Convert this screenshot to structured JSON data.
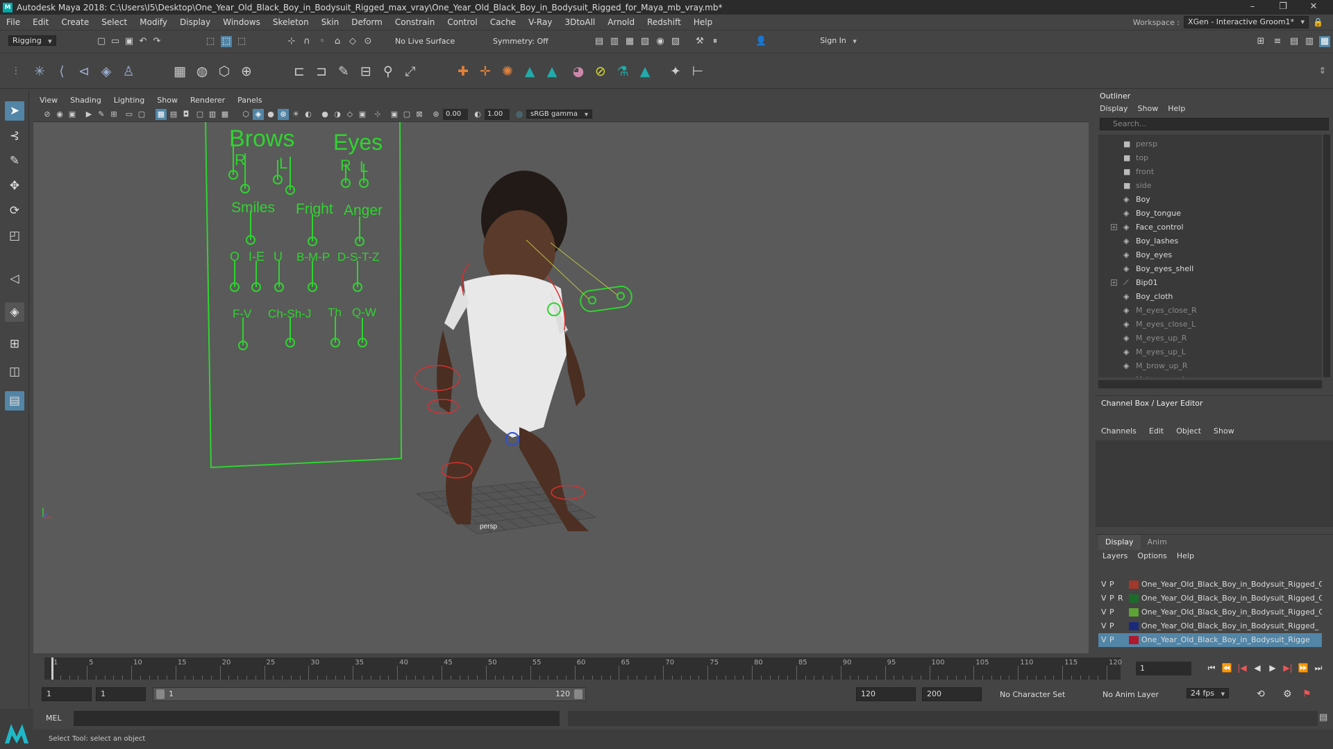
{
  "window": {
    "title": "Autodesk Maya 2018: C:\\Users\\I5\\Desktop\\One_Year_Old_Black_Boy_in_Bodysuit_Rigged_max_vray\\One_Year_Old_Black_Boy_in_Bodysuit_Rigged_for_Maya_mb_vray.mb*",
    "app_icon": "M"
  },
  "menubar": [
    "File",
    "Edit",
    "Create",
    "Select",
    "Modify",
    "Display",
    "Windows",
    "Skeleton",
    "Skin",
    "Deform",
    "Constrain",
    "Control",
    "Cache",
    "V-Ray",
    "3DtoAll",
    "Arnold",
    "Redshift",
    "Help"
  ],
  "workspace": {
    "label": "Workspace :",
    "value": "XGen - Interactive Groom1*"
  },
  "statusline": {
    "mode": "Rigging",
    "live_surface": "No Live Surface",
    "symmetry": "Symmetry: Off",
    "signin": "Sign In"
  },
  "viewport": {
    "menu": [
      "View",
      "Shading",
      "Lighting",
      "Show",
      "Renderer",
      "Panels"
    ],
    "field1": "0.00",
    "field2": "1.00",
    "colorspace": "sRGB gamma",
    "camera_label": "persp",
    "rig": {
      "brows": "Brows",
      "eyes": "Eyes",
      "r": "R",
      "l": "L",
      "eyes_r": "R",
      "eyes_l": "L",
      "smiles": "Smiles",
      "fright": "Fright",
      "anger": "Anger",
      "o": "O",
      "ie": "I-E",
      "u": "U",
      "bmp": "B-M-P",
      "dstz": "D-S-T-Z",
      "fv": "F-V",
      "chshj": "Ch-Sh-J",
      "th": "Th",
      "qw": "Q-W"
    }
  },
  "outliner": {
    "title": "Outliner",
    "menu": [
      "Display",
      "Show",
      "Help"
    ],
    "search_placeholder": "Search...",
    "items": [
      {
        "name": "persp",
        "type": "camera",
        "dim": true,
        "expand": false
      },
      {
        "name": "top",
        "type": "camera",
        "dim": true,
        "expand": false
      },
      {
        "name": "front",
        "type": "camera",
        "dim": true,
        "expand": false
      },
      {
        "name": "side",
        "type": "camera",
        "dim": true,
        "expand": false
      },
      {
        "name": "Boy",
        "type": "mesh",
        "dim": false,
        "expand": false
      },
      {
        "name": "Boy_tongue",
        "type": "mesh",
        "dim": false,
        "expand": false
      },
      {
        "name": "Face_control",
        "type": "mesh",
        "dim": false,
        "expand": true
      },
      {
        "name": "Boy_lashes",
        "type": "mesh",
        "dim": false,
        "expand": false
      },
      {
        "name": "Boy_eyes",
        "type": "mesh",
        "dim": false,
        "expand": false
      },
      {
        "name": "Boy_eyes_shell",
        "type": "mesh",
        "dim": false,
        "expand": false
      },
      {
        "name": "Bip01",
        "type": "joint",
        "dim": false,
        "expand": true
      },
      {
        "name": "Boy_cloth",
        "type": "mesh",
        "dim": false,
        "expand": false
      },
      {
        "name": "M_eyes_close_R",
        "type": "mesh",
        "dim": true,
        "expand": false
      },
      {
        "name": "M_eyes_close_L",
        "type": "mesh",
        "dim": true,
        "expand": false
      },
      {
        "name": "M_eyes_up_R",
        "type": "mesh",
        "dim": true,
        "expand": false
      },
      {
        "name": "M_eyes_up_L",
        "type": "mesh",
        "dim": true,
        "expand": false
      },
      {
        "name": "M_brow_up_R",
        "type": "mesh",
        "dim": true,
        "expand": false
      },
      {
        "name": "M_brow_up_L",
        "type": "mesh",
        "dim": true,
        "expand": false
      }
    ]
  },
  "channelbox": {
    "title": "Channel Box / Layer Editor",
    "menu": [
      "Channels",
      "Edit",
      "Object",
      "Show"
    ]
  },
  "layereditor": {
    "tabs": [
      "Display",
      "Anim"
    ],
    "menu": [
      "Layers",
      "Options",
      "Help"
    ],
    "layers": [
      {
        "v": "V",
        "p": "P",
        "r": "",
        "color": "#a0392a",
        "name": "One_Year_Old_Black_Boy_in_Bodysuit_Rigged_Cont",
        "selected": false
      },
      {
        "v": "V",
        "p": "P",
        "r": "R",
        "color": "#1d6b2a",
        "name": "One_Year_Old_Black_Boy_in_Bodysuit_Rigged_Cont",
        "selected": false
      },
      {
        "v": "V",
        "p": "P",
        "r": "",
        "color": "#5ea335",
        "name": "One_Year_Old_Black_Boy_in_Bodysuit_Rigged_Cont",
        "selected": false
      },
      {
        "v": "V",
        "p": "P",
        "r": "",
        "color": "#1b2a7a",
        "name": "One_Year_Old_Black_Boy_in_Bodysuit_Rigged_",
        "selected": false
      },
      {
        "v": "V",
        "p": "P",
        "r": "",
        "color": "#b0182e",
        "name": "One_Year_Old_Black_Boy_in_Bodysuit_Rigge",
        "selected": true
      }
    ]
  },
  "timeline": {
    "ticks": [
      1,
      5,
      10,
      15,
      20,
      25,
      30,
      35,
      40,
      45,
      50,
      55,
      60,
      65,
      70,
      75,
      80,
      85,
      90,
      95,
      100,
      105,
      110,
      115,
      120
    ],
    "current_frame": "1"
  },
  "range": {
    "start": "1",
    "playback_start": "1",
    "slider_start": "1",
    "slider_end": "120",
    "playback_end": "120",
    "end": "200",
    "character_set": "No Character Set",
    "anim_layer": "No Anim Layer",
    "fps": "24 fps"
  },
  "command": {
    "lang": "MEL",
    "help_text": "Select Tool: select an object"
  }
}
